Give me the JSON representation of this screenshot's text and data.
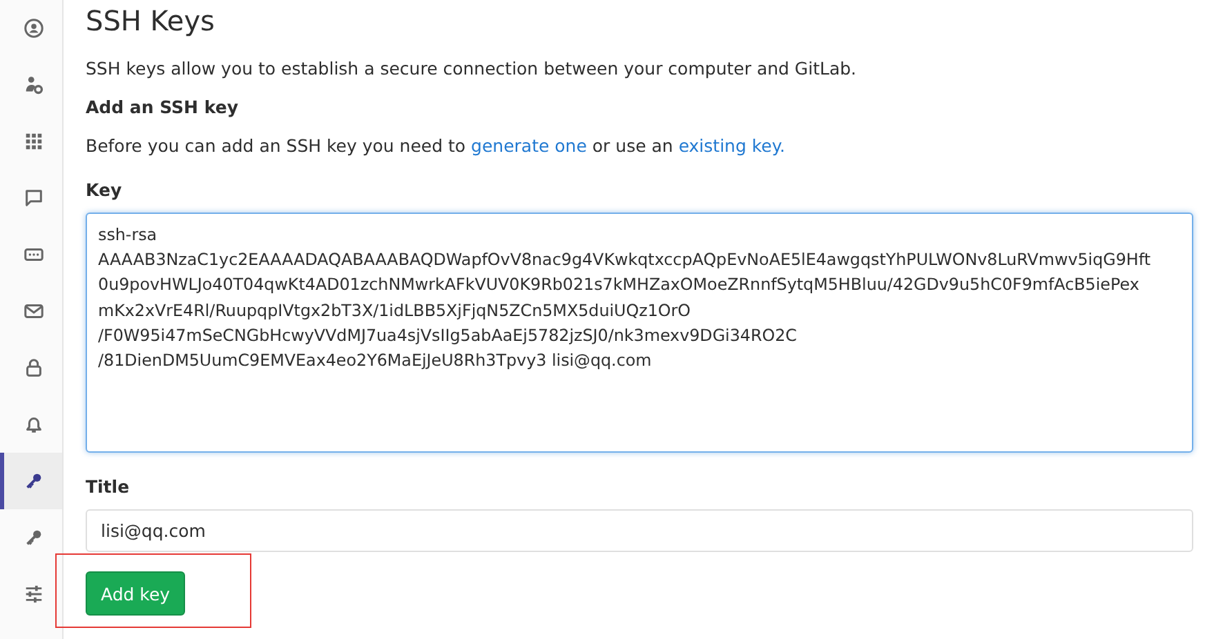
{
  "sidebar": {
    "items": [
      {
        "selected": false
      },
      {
        "selected": false
      },
      {
        "selected": false
      },
      {
        "selected": false
      },
      {
        "selected": false
      },
      {
        "selected": false
      },
      {
        "selected": false
      },
      {
        "selected": false
      },
      {
        "selected": true
      },
      {
        "selected": false
      },
      {
        "selected": false
      }
    ]
  },
  "page": {
    "title": "SSH Keys",
    "intro": "SSH keys allow you to establish a secure connection between your computer and GitLab.",
    "subtitle": "Add an SSH key",
    "hint": {
      "before": "Before you can add an SSH key you need to",
      "link1": "generate one",
      "middle": "or use an",
      "link2": "existing key."
    },
    "key": {
      "label": "Key",
      "value_lines": [
        "ssh-rsa",
        "AAAAB3NzaC1yc2EAAAADAQABAAABAQDWapfOvV8nac9g4VKwkqtxccpAQpEvNoAE5lE4awgqstYhPULWONv8LuRVmwv5iqG9Hft",
        "0u9povHWLJo40T04qwKt4AD01zchNMwrkAFkVUV0K9Rb021s7kMHZaxOMoeZRnnfSytqM5HBluu/42GDv9u5hC0F9mfAcB5iePex",
        "mKx2xVrE4Rl/RuupqpIVtgx2bT3X/1idLBB5XjFjqN5ZCn5MX5duiUQz1OrO",
        "/F0W95i47mSeCNGbHcwyVVdMJ7ua4sjVsIIg5abAaEj5782jzSJ0/nk3mexv9DGi34RO2C",
        "/81DienDM5UumC9EMVEax4eo2Y6MaEjJeU8Rh3Tpvy3 lisi@qq.com"
      ]
    },
    "title_field": {
      "label": "Title",
      "value": "lisi@qq.com"
    },
    "button": "Add key"
  }
}
